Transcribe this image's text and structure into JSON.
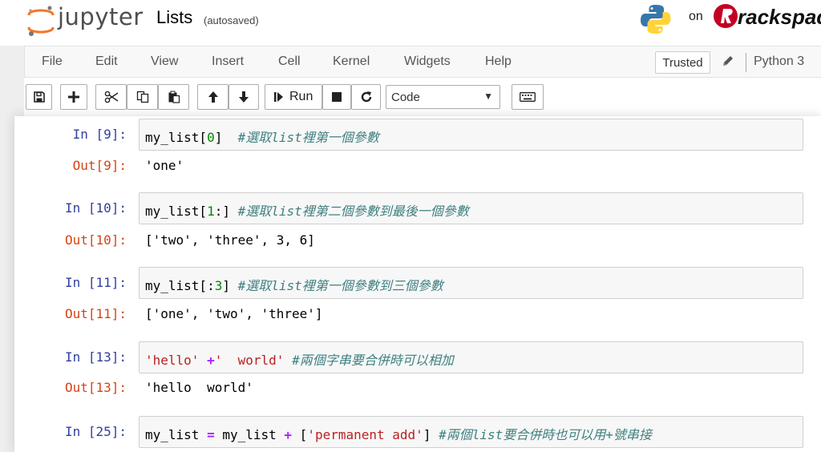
{
  "header": {
    "logo_text": "jupyter",
    "notebook_title": "Lists",
    "autosave_status": "(autosaved)",
    "hosted_on": "on",
    "host_brand": "rackspace"
  },
  "menu": {
    "items": [
      "File",
      "Edit",
      "View",
      "Insert",
      "Cell",
      "Kernel",
      "Widgets",
      "Help"
    ],
    "trusted_label": "Trusted",
    "kernel_name": "Python 3"
  },
  "toolbar": {
    "run_label": "Run",
    "cell_type": "Code",
    "buttons": [
      "save-icon",
      "add-cell-icon",
      "cut-icon",
      "copy-icon",
      "paste-icon",
      "move-up-icon",
      "move-down-icon",
      "run-icon",
      "stop-icon",
      "restart-icon",
      "keyboard-icon"
    ]
  },
  "cells": [
    {
      "in_prompt": "In [9]:",
      "code": {
        "a": "my_list[",
        "num": "0",
        "b": "]  ",
        "comment": "#選取list裡第一個參數"
      },
      "out_prompt": "Out[9]:",
      "output": "'one'"
    },
    {
      "in_prompt": "In [10]:",
      "code": {
        "a": "my_list[",
        "num": "1",
        "op": ":",
        "b": "] ",
        "comment": "#選取list裡第二個參數到最後一個參數"
      },
      "out_prompt": "Out[10]:",
      "output": "['two', 'three', 3, 6]"
    },
    {
      "in_prompt": "In [11]:",
      "code": {
        "a": "my_list[",
        "op": ":",
        "num": "3",
        "b": "] ",
        "comment": "#選取list裡第一個參數到三個參數"
      },
      "out_prompt": "Out[11]:",
      "output": "['one', 'two', 'three']"
    },
    {
      "in_prompt": "In [13]:",
      "code": {
        "s1": "'hello'",
        "sp1": " ",
        "op": "+",
        "s2": "'  world'",
        "sp2": " ",
        "comment": "#兩個字串要合併時可以相加"
      },
      "out_prompt": "Out[13]:",
      "output": "'hello  world'"
    },
    {
      "in_prompt": "In [25]:",
      "code": {
        "a": "my_list ",
        "op1": "=",
        "b": " my_list ",
        "op2": "+",
        "c": " [",
        "s": "'permanent add'",
        "d": "] ",
        "comment": "#兩個list要合併時也可以用+號串接"
      }
    }
  ],
  "colors": {
    "in_prompt": "#303f9f",
    "out_prompt": "#d84315",
    "number": "#008800",
    "operator": "#aa22ff",
    "string": "#ba2121",
    "comment": "#408080"
  }
}
